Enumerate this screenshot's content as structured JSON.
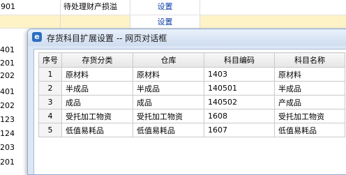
{
  "background": {
    "rows": [
      {
        "code": "901",
        "name": "待处理财产损溢",
        "link": "设置"
      },
      {
        "code": "",
        "name": "",
        "link": "设置"
      }
    ],
    "codes": [
      "401",
      "201",
      "202",
      "401",
      "202",
      "123",
      "124",
      "203",
      "201"
    ]
  },
  "dialog": {
    "title": "存货科目扩展设置 -- 网页对话框",
    "icon": "ie-page-icon",
    "columns": [
      "序号",
      "存货分类",
      "仓库",
      "科目编码",
      "科目名称"
    ],
    "rows": [
      {
        "idx": "1",
        "category": "原材料",
        "warehouse": "原材料",
        "code": "1403",
        "name": "原材料"
      },
      {
        "idx": "2",
        "category": "半成品",
        "warehouse": "半成品",
        "code": "140501",
        "name": "半成品"
      },
      {
        "idx": "3",
        "category": "成品",
        "warehouse": "成品",
        "code": "140502",
        "name": "产成品"
      },
      {
        "idx": "4",
        "category": "受托加工物资",
        "warehouse": "受托加工物资",
        "code": "1608",
        "name": "受托加工物资"
      },
      {
        "idx": "5",
        "category": "低值易耗品",
        "warehouse": "低值易耗品",
        "code": "1607",
        "name": "低值易耗品"
      }
    ]
  }
}
